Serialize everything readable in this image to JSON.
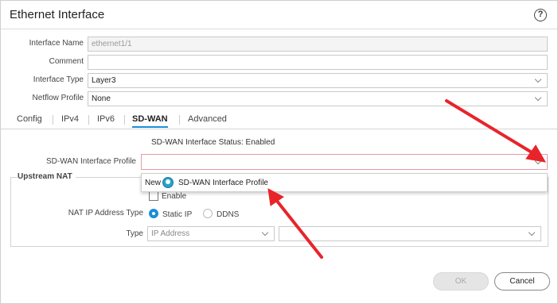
{
  "dialog": {
    "title": "Ethernet Interface",
    "help_icon": "?"
  },
  "form": {
    "interface_name_label": "Interface Name",
    "interface_name_value": "ethernet1/1",
    "comment_label": "Comment",
    "comment_value": "",
    "interface_type_label": "Interface Type",
    "interface_type_value": "Layer3",
    "netflow_profile_label": "Netflow Profile",
    "netflow_profile_value": "None"
  },
  "tabs": [
    "Config",
    "IPv4",
    "IPv6",
    "SD-WAN",
    "Advanced"
  ],
  "sdwan": {
    "status_text": "SD-WAN Interface Status: Enabled",
    "profile_label": "SD-WAN Interface Profile",
    "profile_value": "",
    "dropdown_new": "New",
    "dropdown_item": "SD-WAN Interface Profile"
  },
  "upstream_nat": {
    "title": "Upstream NAT",
    "enable_label": "Enable",
    "nat_ip_type_label": "NAT IP Address Type",
    "static_ip_label": "Static IP",
    "ddns_label": "DDNS",
    "type_label": "Type",
    "type_value": "IP Address",
    "address_value": ""
  },
  "buttons": {
    "ok": "OK",
    "cancel": "Cancel"
  },
  "colors": {
    "accent": "#1a8fd6",
    "annotation_arrow": "#e8242b",
    "error_border": "#e79aa4"
  }
}
